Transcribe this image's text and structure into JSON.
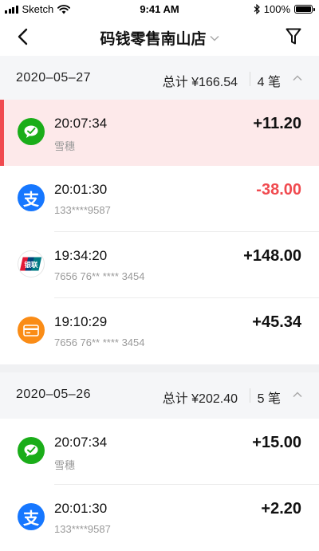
{
  "status_bar": {
    "carrier": "Sketch",
    "time": "9:41 AM",
    "battery": "100%"
  },
  "nav": {
    "title": "码钱零售南山店"
  },
  "colors": {
    "accent_red": "#f04a4f",
    "wechat_green": "#1aad19",
    "alipay_blue": "#1677ff",
    "card_orange": "#fa8c16"
  },
  "groups": [
    {
      "date": "2020–05–27",
      "total": "总计 ¥166.54",
      "count": "4 笔",
      "transactions": [
        {
          "icon": "wechat-pay-icon",
          "time": "20:07:34",
          "sub": "雪穗",
          "amount": "+11.20",
          "negative": false,
          "highlighted": true
        },
        {
          "icon": "alipay-icon",
          "time": "20:01:30",
          "sub": "133****9587",
          "amount": "-38.00",
          "negative": true,
          "highlighted": false
        },
        {
          "icon": "unionpay-icon",
          "time": "19:34:20",
          "sub": "7656 76** **** 3454",
          "amount": "+148.00",
          "negative": false,
          "highlighted": false
        },
        {
          "icon": "bank-card-icon",
          "time": "19:10:29",
          "sub": "7656 76** **** 3454",
          "amount": "+45.34",
          "negative": false,
          "highlighted": false
        }
      ]
    },
    {
      "date": "2020–05–26",
      "total": "总计 ¥202.40",
      "count": "5 笔",
      "transactions": [
        {
          "icon": "wechat-pay-icon",
          "time": "20:07:34",
          "sub": "雪穗",
          "amount": "+15.00",
          "negative": false,
          "highlighted": false
        },
        {
          "icon": "alipay-icon",
          "time": "20:01:30",
          "sub": "133****9587",
          "amount": "+2.20",
          "negative": false,
          "highlighted": false
        }
      ]
    }
  ]
}
